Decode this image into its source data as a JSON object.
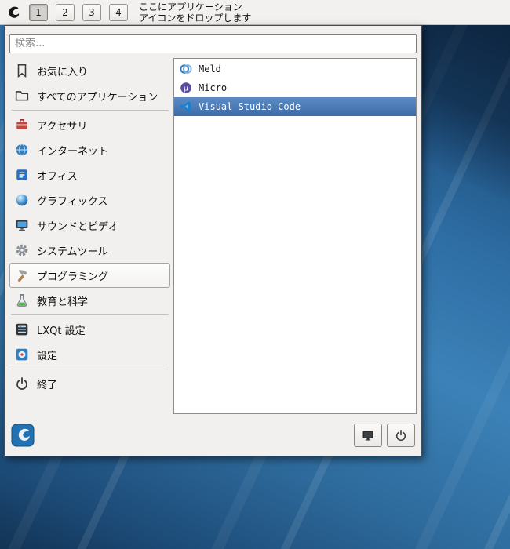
{
  "panel": {
    "logo_icon": "lxqt-bird-icon",
    "workspaces": [
      "1",
      "2",
      "3",
      "4"
    ],
    "active_workspace": "1",
    "drop_hint_line1": "ここにアプリケーション",
    "drop_hint_line2": "アイコンをドロップします"
  },
  "menu": {
    "search": {
      "placeholder": "検索..."
    },
    "categories": [
      {
        "id": "favorites",
        "label": "お気に入り",
        "icon": "bookmark-icon"
      },
      {
        "id": "all-applications",
        "label": "すべてのアプリケーション",
        "icon": "folder-icon",
        "separator_after": true
      },
      {
        "id": "accessories",
        "label": "アクセサリ",
        "icon": "toolbox-icon"
      },
      {
        "id": "internet",
        "label": "インターネット",
        "icon": "globe-icon"
      },
      {
        "id": "office",
        "label": "オフィス",
        "icon": "office-icon"
      },
      {
        "id": "graphics",
        "label": "グラフィックス",
        "icon": "sphere-icon"
      },
      {
        "id": "sound-video",
        "label": "サウンドとビデオ",
        "icon": "monitor-icon"
      },
      {
        "id": "system-tools",
        "label": "システムツール",
        "icon": "gear-icon"
      },
      {
        "id": "programming",
        "label": "プログラミング",
        "icon": "hammer-icon",
        "selected": true
      },
      {
        "id": "education-science",
        "label": "教育と科学",
        "icon": "flask-icon",
        "separator_after": true
      },
      {
        "id": "lxqt-settings",
        "label": "LXQt 設定",
        "icon": "lxqt-settings-icon"
      },
      {
        "id": "preferences",
        "label": "設定",
        "icon": "preferences-icon",
        "separator_after": true
      },
      {
        "id": "leave",
        "label": "終了",
        "icon": "power-icon"
      }
    ],
    "apps": [
      {
        "id": "meld",
        "label": "Meld",
        "icon": "meld-icon"
      },
      {
        "id": "micro",
        "label": "Micro",
        "icon": "micro-icon"
      },
      {
        "id": "vscode",
        "label": "Visual Studio Code",
        "icon": "vscode-icon",
        "selected": true
      }
    ],
    "footer": {
      "logo_icon": "lxqt-logo-icon",
      "buttons": [
        {
          "id": "lock-screen",
          "icon": "screen-lock-icon"
        },
        {
          "id": "power",
          "icon": "power-icon"
        }
      ]
    }
  },
  "colors": {
    "selection_blue": "#4a7ab8",
    "panel_bg": "#f2f1ef",
    "menu_bg": "#f1f0ee",
    "wallpaper_mid": "#3c82b8"
  }
}
